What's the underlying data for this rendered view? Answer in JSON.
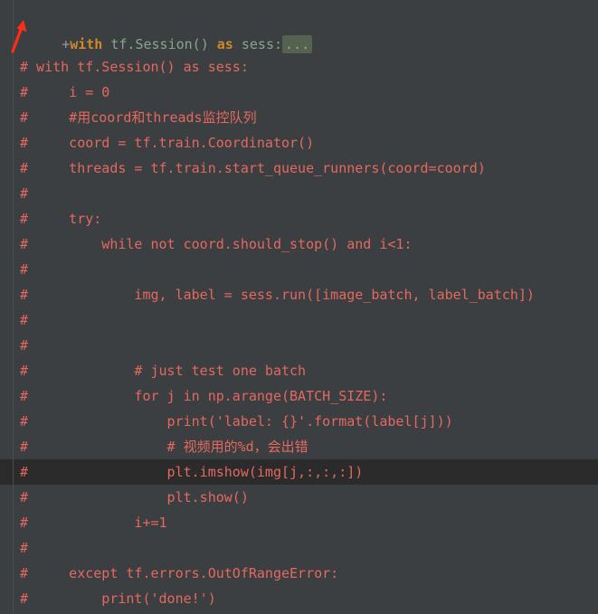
{
  "editor": {
    "theme_background": "#3c3f41",
    "current_line_background": "#2b2b2b",
    "comment_color": "#e5685f",
    "keyword_color": "#cc8a29",
    "identifier_color": "#88a58c",
    "fold_placeholder_background": "#55624f",
    "annotation_arrow_color": "#ff2d16"
  },
  "folded_line": {
    "fold_toggle": "+",
    "kw_with": "with",
    "module": " tf.Session() ",
    "kw_as": "as",
    "variable": " sess",
    "colon": ":",
    "fold_placeholder": "..."
  },
  "annotation": {
    "arrow_name": "red-arrow-pointing-to-fold-toggle",
    "color": "#ff2d16"
  },
  "lines": [
    {
      "text": "# with tf.Session() as sess:",
      "current": false
    },
    {
      "text": "#     i = 0",
      "current": false
    },
    {
      "text": "#     #用coord和threads监控队列",
      "current": false
    },
    {
      "text": "#     coord = tf.train.Coordinator()",
      "current": false
    },
    {
      "text": "#     threads = tf.train.start_queue_runners(coord=coord)",
      "current": false
    },
    {
      "text": "#",
      "current": false
    },
    {
      "text": "#     try:",
      "current": false
    },
    {
      "text": "#         while not coord.should_stop() and i<1:",
      "current": false
    },
    {
      "text": "#",
      "current": false
    },
    {
      "text": "#             img, label = sess.run([image_batch, label_batch])",
      "current": false
    },
    {
      "text": "#",
      "current": false
    },
    {
      "text": "#",
      "current": false
    },
    {
      "text": "#             # just test one batch",
      "current": false
    },
    {
      "text": "#             for j in np.arange(BATCH_SIZE):",
      "current": false
    },
    {
      "text": "#                 print('label: {}'.format(label[j]))",
      "current": false
    },
    {
      "text": "#                 # 视频用的%d，会出错",
      "current": false
    },
    {
      "text": "#                 plt.imshow(img[j,:,:,:])",
      "current": true
    },
    {
      "text": "#                 plt.show()",
      "current": false
    },
    {
      "text": "#             i+=1",
      "current": false
    },
    {
      "text": "#",
      "current": false
    },
    {
      "text": "#     except tf.errors.OutOfRangeError:",
      "current": false
    },
    {
      "text": "#         print('done!')",
      "current": false
    }
  ]
}
